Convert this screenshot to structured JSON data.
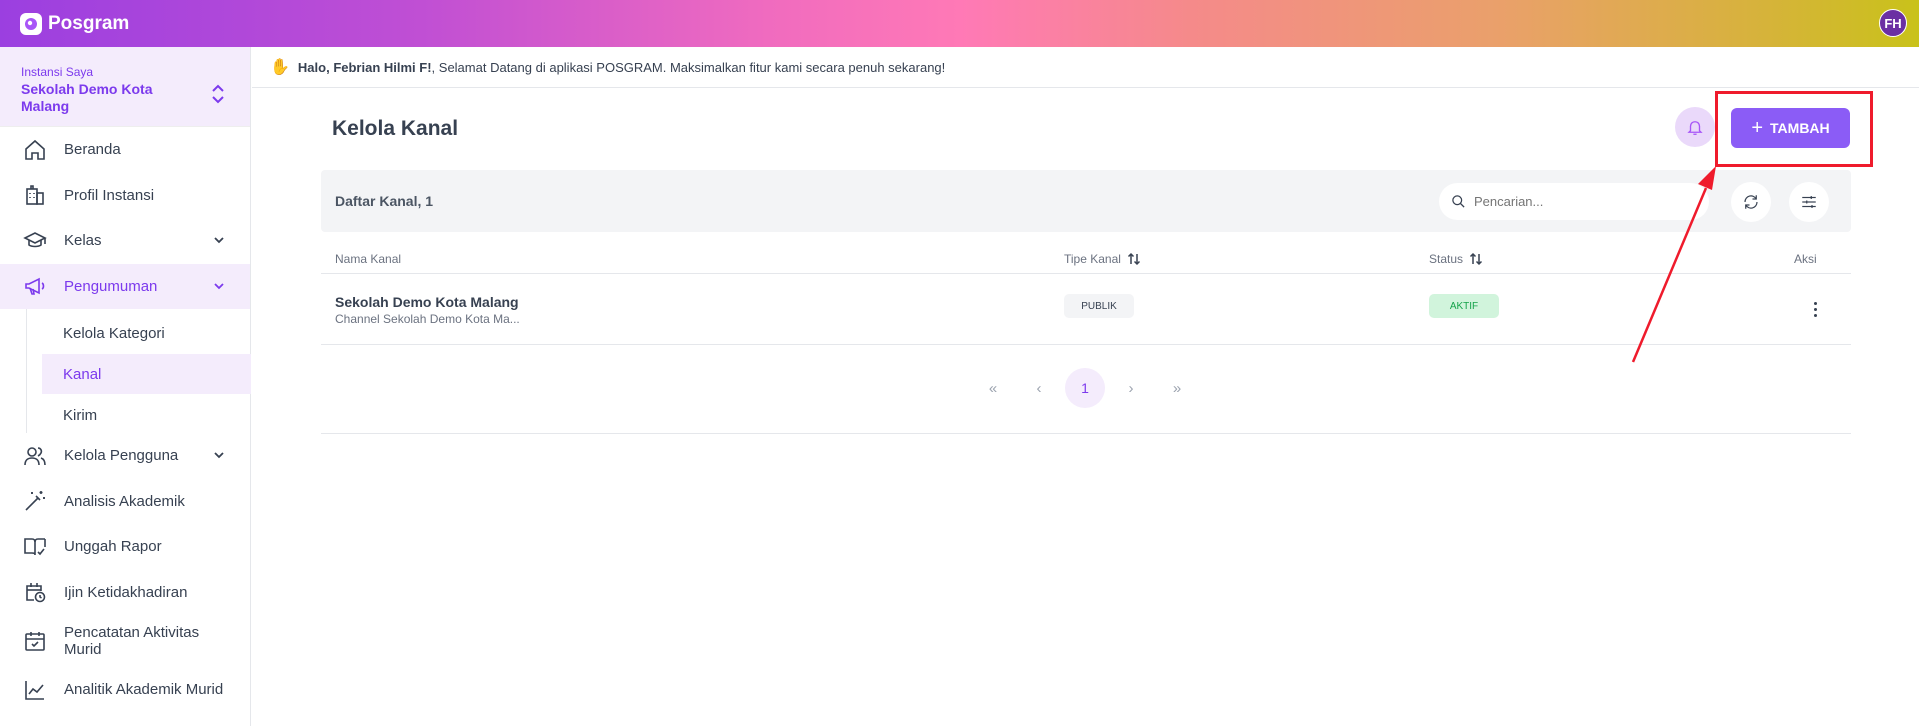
{
  "app": {
    "name": "Posgram",
    "avatar_initials": "FH"
  },
  "sidebar": {
    "instansi_label": "Instansi Saya",
    "instansi_name": "Sekolah Demo Kota Malang",
    "items": [
      {
        "label": "Beranda",
        "icon": "home-icon"
      },
      {
        "label": "Profil Instansi",
        "icon": "building-icon"
      },
      {
        "label": "Kelas",
        "icon": "graduation-cap-icon"
      },
      {
        "label": "Pengumuman",
        "icon": "megaphone-icon"
      },
      {
        "label": "Kelola Pengguna",
        "icon": "users-icon"
      },
      {
        "label": "Analisis Akademik",
        "icon": "magic-wand-icon"
      },
      {
        "label": "Unggah Rapor",
        "icon": "book-check-icon"
      },
      {
        "label": "Ijin Ketidakhadiran",
        "icon": "calendar-clock-icon"
      },
      {
        "label": "Pencatatan Aktivitas Murid",
        "icon": "calendar-check-icon"
      },
      {
        "label": "Analitik Akademik Murid",
        "icon": "line-chart-icon"
      }
    ],
    "pengumuman_sub": [
      {
        "label": "Kelola Kategori"
      },
      {
        "label": "Kanal"
      },
      {
        "label": "Kirim"
      }
    ]
  },
  "welcome": {
    "greeting": "Halo, Febrian Hilmi F!",
    "message": ", Selamat Datang di aplikasi POSGRAM. Maksimalkan fitur kami secara penuh sekarang!"
  },
  "main": {
    "title": "Kelola Kanal",
    "add_label": "TAMBAH",
    "list_title": "Daftar Kanal, 1",
    "search_placeholder": "Pencarian...",
    "columns": {
      "name": "Nama Kanal",
      "type": "Tipe Kanal",
      "status": "Status",
      "action": "Aksi"
    },
    "rows": [
      {
        "name": "Sekolah Demo Kota Malang",
        "description": "Channel Sekolah Demo Kota Ma...",
        "type": "PUBLIK",
        "status": "AKTIF"
      }
    ],
    "pagination": {
      "first": "«",
      "prev": "‹",
      "current": "1",
      "next": "›",
      "last": "»"
    }
  },
  "colors": {
    "accent": "#8b5cf6",
    "highlight": "#ef1b2c",
    "active_bg": "#f4ecfc"
  }
}
